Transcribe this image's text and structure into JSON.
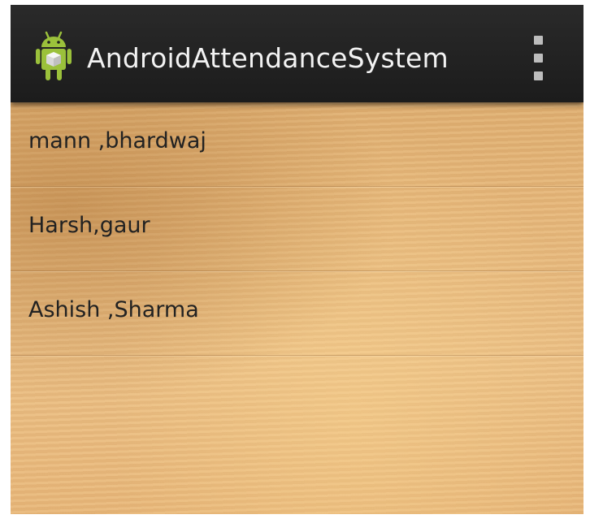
{
  "action_bar": {
    "title": "AndroidAttendanceSystem",
    "app_icon": "android-robot-icon",
    "menu_icon": "overflow-menu-icon"
  },
  "students": [
    {
      "label": "mann ,bhardwaj"
    },
    {
      "label": "Harsh,gaur"
    },
    {
      "label": "Ashish ,Sharma"
    }
  ],
  "colors": {
    "action_bar": "#1f1f1f",
    "title_text": "#f2f2f2",
    "app_icon_green": "#9bc13b",
    "item_text": "#222222",
    "wood_background": "#e5b67a"
  }
}
